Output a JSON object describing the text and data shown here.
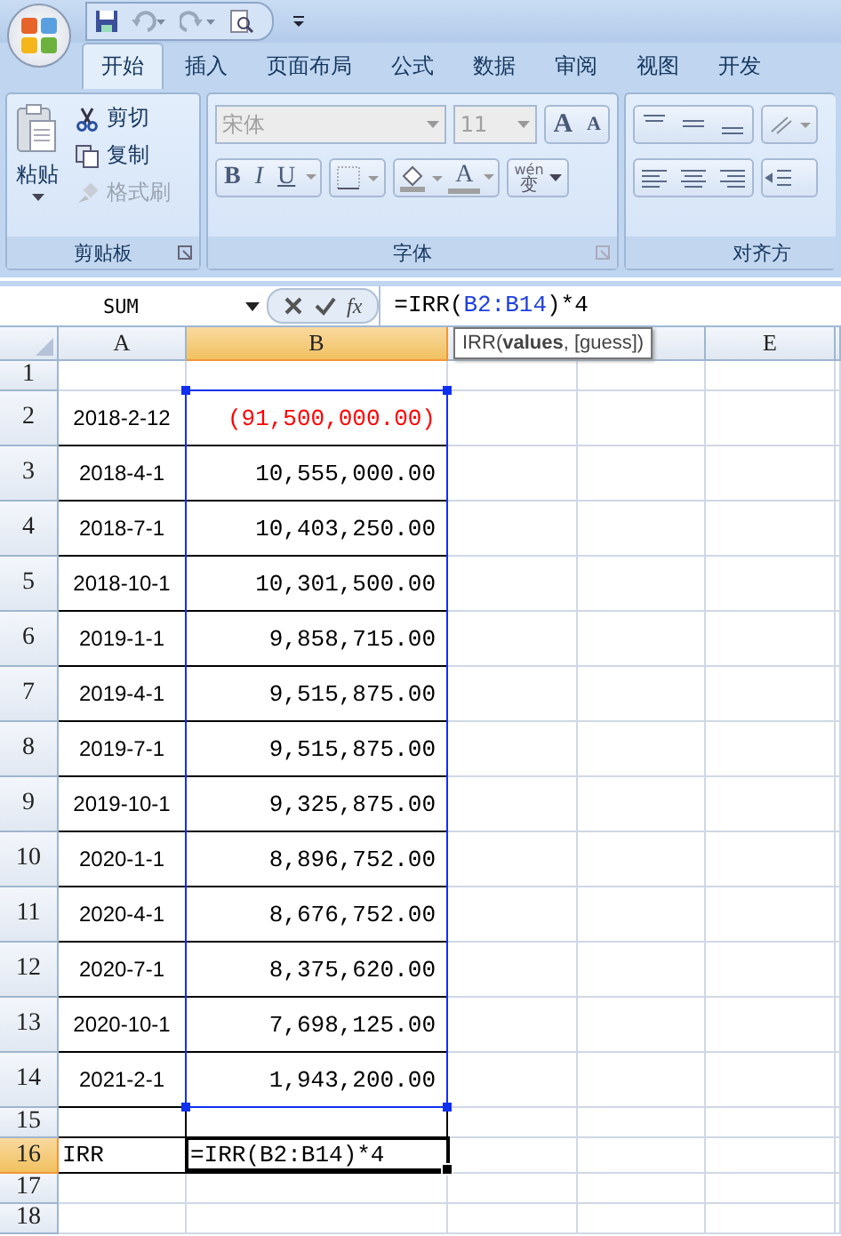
{
  "quick_access": {
    "buttons": [
      {
        "kind": "save"
      },
      {
        "kind": "undo",
        "disabled": true
      },
      {
        "kind": "redo",
        "disabled": true
      },
      {
        "kind": "preview"
      }
    ]
  },
  "ribbon_tabs": [
    {
      "label": "开始",
      "selected": true
    },
    {
      "label": "插入",
      "selected": false
    },
    {
      "label": "页面布局",
      "selected": false
    },
    {
      "label": "公式",
      "selected": false
    },
    {
      "label": "数据",
      "selected": false
    },
    {
      "label": "审阅",
      "selected": false
    },
    {
      "label": "视图",
      "selected": false
    },
    {
      "label": "开发",
      "selected": false
    }
  ],
  "clipboard_group": {
    "title": "剪贴板",
    "paste": "粘贴",
    "items": [
      {
        "label": "剪切",
        "kind": "cut",
        "disabled": false
      },
      {
        "label": "复制",
        "kind": "copy",
        "disabled": false
      },
      {
        "label": "格式刷",
        "kind": "brush",
        "disabled": true
      }
    ]
  },
  "font_group": {
    "title": "字体",
    "font": "宋体",
    "size": "11",
    "disabled": true,
    "grow": "A",
    "shrink": "A",
    "bold": "B",
    "italic": "I",
    "underline": "U",
    "font_color": "A",
    "phonetic": "wén",
    "phonetic_char": "变"
  },
  "align_group": {
    "title": "对齐方"
  },
  "formula_bar": {
    "name_box": "SUM",
    "fx": "fx",
    "formula": {
      "before": "=IRR(",
      "ref": "B2:B14",
      "after": ")*4"
    },
    "tooltip": "IRR(**values**, [guess])"
  },
  "columns": [
    {
      "label": "A",
      "selected": false
    },
    {
      "label": "B",
      "selected": true
    },
    {
      "selected": false
    },
    {
      "selected": false
    },
    {
      "label": "E",
      "selected": false
    }
  ],
  "rows": [
    {
      "number": "1",
      "selected": false
    },
    {
      "number": "2",
      "selected": false,
      "a": "2018-2-12",
      "b": "(91,500,000.00)",
      "color": "#ff0000"
    },
    {
      "number": "3",
      "selected": false,
      "a": "2018-4-1",
      "b": "10,555,000.00"
    },
    {
      "number": "4",
      "selected": false,
      "a": "2018-7-1",
      "b": "10,403,250.00"
    },
    {
      "number": "5",
      "selected": false,
      "a": "2018-10-1",
      "b": "10,301,500.00"
    },
    {
      "number": "6",
      "selected": false,
      "a": "2019-1-1",
      "b": "9,858,715.00"
    },
    {
      "number": "7",
      "selected": false,
      "a": "2019-4-1",
      "b": "9,515,875.00"
    },
    {
      "number": "8",
      "selected": false,
      "a": "2019-7-1",
      "b": "9,515,875.00"
    },
    {
      "number": "9",
      "selected": false,
      "a": "2019-10-1",
      "b": "9,325,875.00"
    },
    {
      "number": "10",
      "selected": false,
      "a": "2020-1-1",
      "b": "8,896,752.00"
    },
    {
      "number": "11",
      "selected": false,
      "a": "2020-4-1",
      "b": "8,676,752.00"
    },
    {
      "number": "12",
      "selected": false,
      "a": "2020-7-1",
      "b": "8,375,620.00"
    },
    {
      "number": "13",
      "selected": false,
      "a": "2020-10-1",
      "b": "7,698,125.00"
    },
    {
      "number": "14",
      "selected": false,
      "a": "2021-2-1",
      "b": "1,943,200.00"
    },
    {
      "number": "15",
      "selected": false
    },
    {
      "number": "16",
      "selected": true,
      "a": "IRR",
      "b": "=IRR(B2:B14)*4"
    },
    {
      "number": "17",
      "selected": false
    },
    {
      "number": "18",
      "selected": false
    }
  ]
}
